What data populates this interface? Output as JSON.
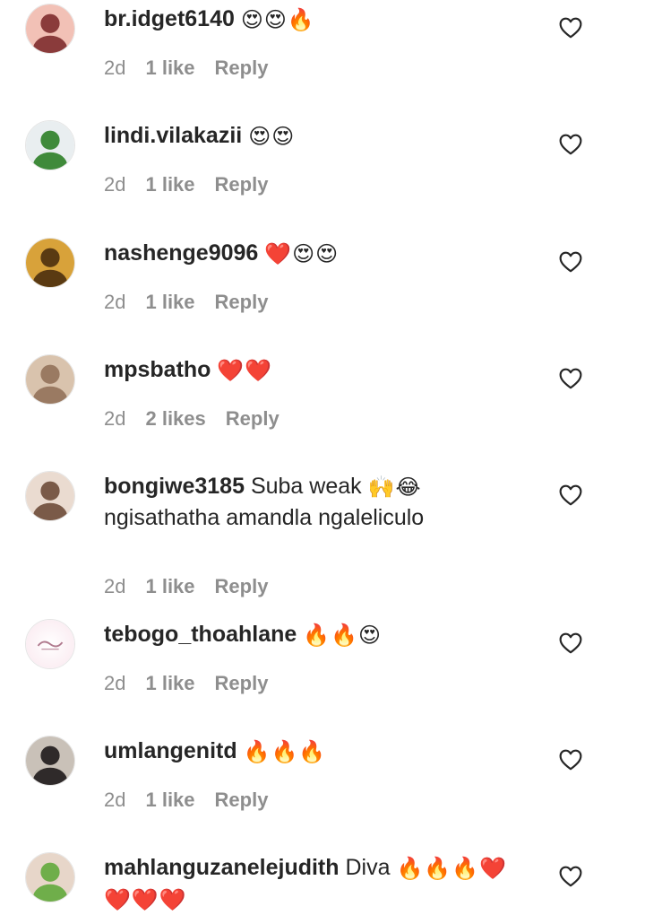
{
  "comments": [
    {
      "username": "br.idget6140",
      "body": "",
      "emojis": "😍😍🔥",
      "time": "2d",
      "likes": "1 like",
      "reply": "Reply",
      "avatar_icon": "profile-photo",
      "avatar_colors": [
        "#8a3b3b",
        "#f2c1b6"
      ]
    },
    {
      "username": "lindi.vilakazii",
      "body": "",
      "emojis": "😍😍",
      "time": "2d",
      "likes": "1 like",
      "reply": "Reply",
      "avatar_icon": "profile-photo",
      "avatar_colors": [
        "#3f8a3a",
        "#e9eef0"
      ]
    },
    {
      "username": "nashenge9096",
      "body": "",
      "emojis": "❤️😍😍",
      "time": "2d",
      "likes": "1 like",
      "reply": "Reply",
      "avatar_icon": "profile-photo",
      "avatar_colors": [
        "#5a3a12",
        "#d8a23a"
      ]
    },
    {
      "username": "mpsbatho",
      "body": "",
      "emojis": "❤️❤️",
      "time": "2d",
      "likes": "2 likes",
      "reply": "Reply",
      "avatar_icon": "profile-photo",
      "avatar_colors": [
        "#9a7a62",
        "#d9c3ad"
      ]
    },
    {
      "username": "bongiwe3185",
      "body": "Suba weak",
      "emojis": "🙌😂",
      "body2": "ngisathatha amandla ngaleliculo",
      "time": "2d",
      "likes": "1 like",
      "reply": "Reply",
      "avatar_icon": "profile-photo",
      "avatar_colors": [
        "#7a5a48",
        "#eadbd0"
      ]
    },
    {
      "username": "tebogo_thoahlane",
      "body": "",
      "emojis": "🔥🔥😍",
      "time": "2d",
      "likes": "1 like",
      "reply": "Reply",
      "avatar_icon": "logo-avatar",
      "avatar_colors": [
        "#fbeef3",
        "#b07a8e"
      ]
    },
    {
      "username": "umlangenitd",
      "body": "",
      "emojis": "🔥🔥🔥",
      "time": "2d",
      "likes": "1 like",
      "reply": "Reply",
      "avatar_icon": "profile-photo",
      "avatar_colors": [
        "#2f2a2a",
        "#c9c1b8"
      ]
    },
    {
      "username": "mahlanguzanelejudith",
      "body": "Diva",
      "emojis": "🔥🔥🔥❤️",
      "body2": "❤️❤️❤️",
      "time": "",
      "likes": "",
      "reply": "",
      "avatar_icon": "profile-photo",
      "avatar_colors": [
        "#6fae4a",
        "#e7d6c9"
      ]
    }
  ],
  "like_icon": "heart-outline-icon"
}
